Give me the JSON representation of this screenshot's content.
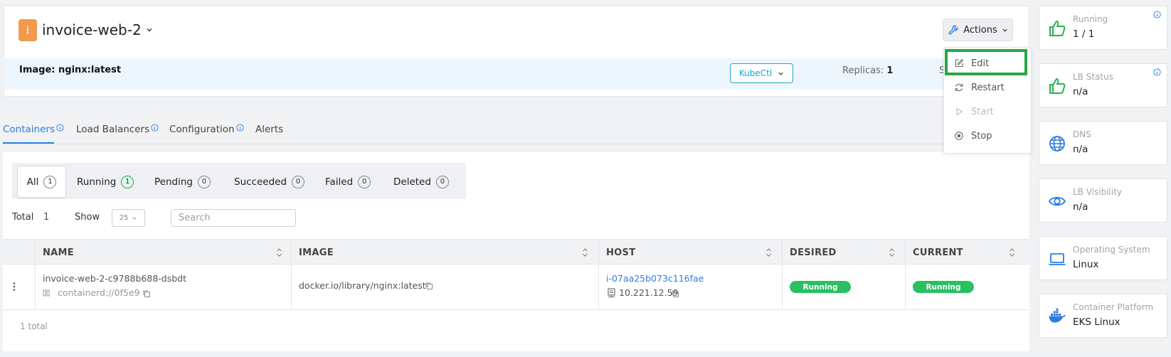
{
  "header": {
    "badge_letter": "i",
    "app_name": "invoice-web-2",
    "actions_label": "Actions",
    "image_label": "Image: nginx:latest",
    "kubectl_label": "KubeCtl",
    "replicas_label": "Replicas:",
    "replicas_value": "1",
    "truncated_letter": "S"
  },
  "actions_menu": {
    "items": [
      {
        "label": "Edit",
        "icon": "edit-icon",
        "enabled": true
      },
      {
        "label": "Restart",
        "icon": "restart-icon",
        "enabled": true
      },
      {
        "label": "Start",
        "icon": "play-icon",
        "enabled": false
      },
      {
        "label": "Stop",
        "icon": "stop-icon",
        "enabled": true
      }
    ]
  },
  "tabs": [
    {
      "label": "Containers",
      "active": true,
      "info": true
    },
    {
      "label": "Load Balancers",
      "active": false,
      "info": true
    },
    {
      "label": "Configuration",
      "active": false,
      "info": true
    },
    {
      "label": "Alerts",
      "active": false,
      "info": false
    }
  ],
  "filters": [
    {
      "label": "All",
      "count": "1",
      "active": true
    },
    {
      "label": "Running",
      "count": "1",
      "active": false
    },
    {
      "label": "Pending",
      "count": "0",
      "active": false
    },
    {
      "label": "Succeeded",
      "count": "0",
      "active": false
    },
    {
      "label": "Failed",
      "count": "0",
      "active": false
    },
    {
      "label": "Deleted",
      "count": "0",
      "active": false
    }
  ],
  "toolbar": {
    "total_label": "Total",
    "total_value": "1",
    "show_label": "Show",
    "page_size": "25",
    "search_placeholder": "Search"
  },
  "table": {
    "columns": [
      "NAME",
      "IMAGE",
      "HOST",
      "DESIRED",
      "CURRENT"
    ],
    "rows": [
      {
        "name": "invoice-web-2-c9788b688-dsbdt",
        "container_id": "containerd://0f5e9",
        "image": "docker.io/library/nginx:latest",
        "host_id": "i-07aa25b073c116fae",
        "host_ip": "10.221.12.59",
        "desired": "Running",
        "current": "Running"
      }
    ],
    "footer": "1 total"
  },
  "stats": [
    {
      "label": "Running",
      "value": "1 / 1",
      "icon": "thumbs-up-icon",
      "info": true
    },
    {
      "label": "LB Status",
      "value": "n/a",
      "icon": "thumbs-up-icon",
      "info": true
    },
    {
      "label": "DNS",
      "value": "n/a",
      "icon": "globe-icon",
      "info": false
    },
    {
      "label": "LB Visibility",
      "value": "n/a",
      "icon": "eye-icon",
      "info": false
    },
    {
      "label": "Operating System",
      "value": "Linux",
      "icon": "laptop-icon",
      "info": false
    },
    {
      "label": "Container Platform",
      "value": "EKS Linux",
      "icon": "docker-icon",
      "info": false
    }
  ],
  "colors": {
    "accent": "#2a7de1",
    "success": "#28c060",
    "badge": "#f19a4c",
    "highlight": "#28a745"
  }
}
